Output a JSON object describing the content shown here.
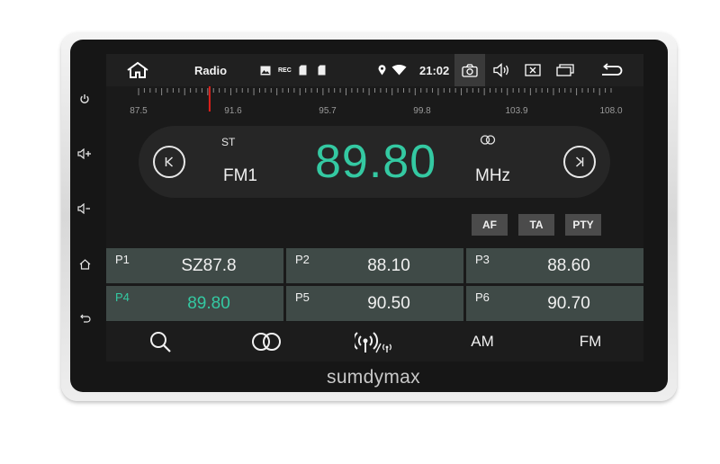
{
  "brand": "sumdymax",
  "side_buttons": [
    {
      "name": "power-icon",
      "glyph": "⏻"
    },
    {
      "name": "volume-up-icon",
      "glyph": "◁+"
    },
    {
      "name": "volume-down-icon",
      "glyph": "◁-"
    },
    {
      "name": "home-icon",
      "glyph": "⌂"
    },
    {
      "name": "back-icon",
      "glyph": "↩"
    }
  ],
  "status_bar": {
    "app_title": "Radio",
    "time": "21:02",
    "rec_label": "REC"
  },
  "dial": {
    "labels": [
      "87.5",
      "91.6",
      "95.7",
      "99.8",
      "103.9",
      "108.0"
    ],
    "indicator_value": 89.8,
    "min": 87.5,
    "max": 108.0
  },
  "tuner": {
    "stereo": "ST",
    "band": "FM1",
    "frequency": "89.80",
    "unit": "MHz"
  },
  "options": {
    "af": "AF",
    "ta": "TA",
    "pty": "PTY"
  },
  "presets": [
    {
      "label": "P1",
      "value": "SZ87.8",
      "active": false
    },
    {
      "label": "P2",
      "value": "88.10",
      "active": false
    },
    {
      "label": "P3",
      "value": "88.60",
      "active": false
    },
    {
      "label": "P4",
      "value": "89.80",
      "active": true
    },
    {
      "label": "P5",
      "value": "90.50",
      "active": false
    },
    {
      "label": "P6",
      "value": "90.70",
      "active": false
    }
  ],
  "bottom_bar": {
    "am": "AM",
    "fm": "FM"
  },
  "colors": {
    "accent": "#34c9a2",
    "indicator": "#e0201b",
    "preset_bg": "#3f4a47"
  }
}
